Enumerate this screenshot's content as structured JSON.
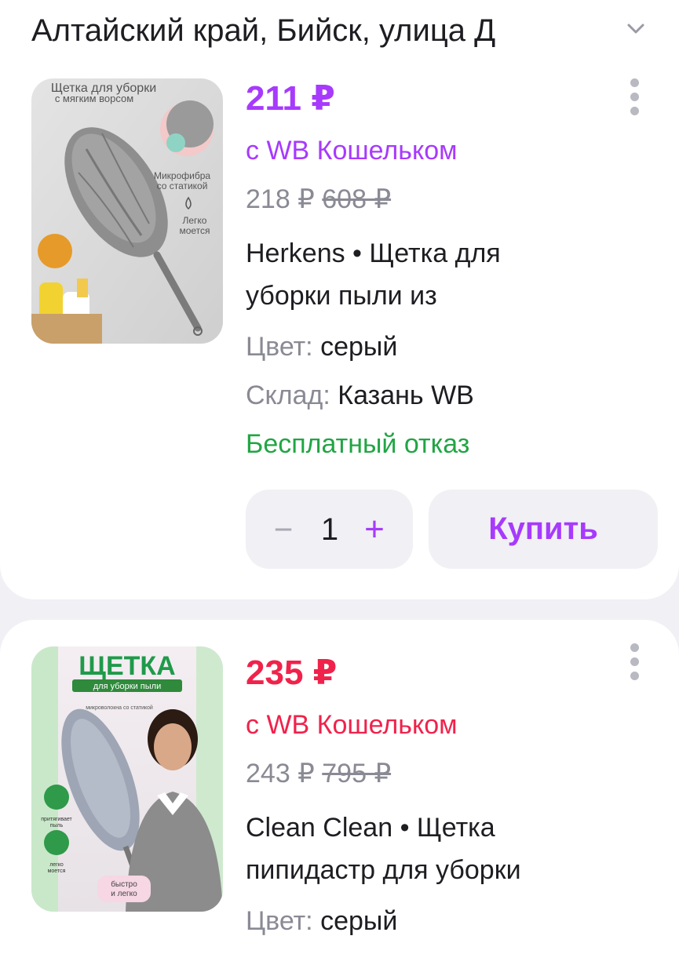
{
  "header": {
    "address": "Алтайский край, Бийск, улица Д"
  },
  "products": [
    {
      "price": "211 ₽",
      "wallet_label": "с WB Кошельком",
      "price_without_wallet": "218 ₽",
      "old_price": "608 ₽",
      "title_line1": "Herkens • Щетка для",
      "title_line2": "уборки пыли из",
      "color_label": "Цвет:",
      "color_value": "серый",
      "warehouse_label": "Склад:",
      "warehouse_value": "Казань WB",
      "return_note": "Бесплатный отказ",
      "quantity": "1",
      "buy_label": "Купить",
      "accent": "#a73afd",
      "image_text": {
        "caption_line1": "Щетка для уборки",
        "caption_line2": "с мягким ворсом",
        "badge1_line1": "Микрофибра",
        "badge1_line2": "со статикой",
        "badge2_line1": "Легко",
        "badge2_line2": "моется"
      }
    },
    {
      "price": "235 ₽",
      "wallet_label": "с WB Кошельком",
      "price_without_wallet": "243 ₽",
      "old_price": "795 ₽",
      "title_line1": "Clean Clean • Щетка",
      "title_line2": "пипидастр для уборки",
      "color_label": "Цвет:",
      "color_value": "серый",
      "accent": "#f0224b",
      "image_text": {
        "heading": "ЩЕТКА",
        "subheading": "для уборки пыли",
        "note": "микроволокна со статикой",
        "feature1_line1": "притягивает",
        "feature1_line2": "пыль",
        "feature2_line1": "легко",
        "feature2_line2": "моется",
        "feature3_line1": "быстро",
        "feature3_line2": "и легко"
      }
    }
  ]
}
